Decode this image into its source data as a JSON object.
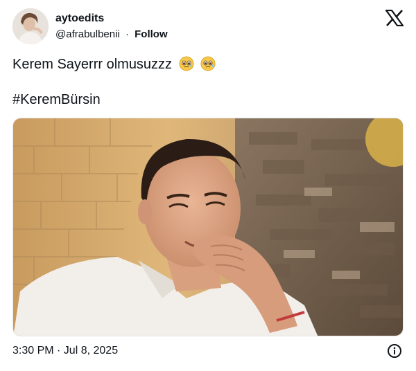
{
  "author": {
    "display_name": "aytoedits",
    "handle": "@afrabulbenii",
    "separator": "·",
    "follow_label": "Follow"
  },
  "tweet": {
    "text": "Kerem Sayerrr olmusuzzz",
    "emojis": [
      "teary-face-emoji",
      "teary-face-emoji"
    ],
    "hashtag": "#KeremBürsin"
  },
  "media": {
    "description_icon": "photo"
  },
  "footer": {
    "timestamp": "3:30 PM · Jul 8, 2025",
    "info_icon": "info-icon"
  },
  "colors": {
    "text": "#0f1419",
    "background": "#ffffff",
    "border": "#e6e6e6"
  }
}
